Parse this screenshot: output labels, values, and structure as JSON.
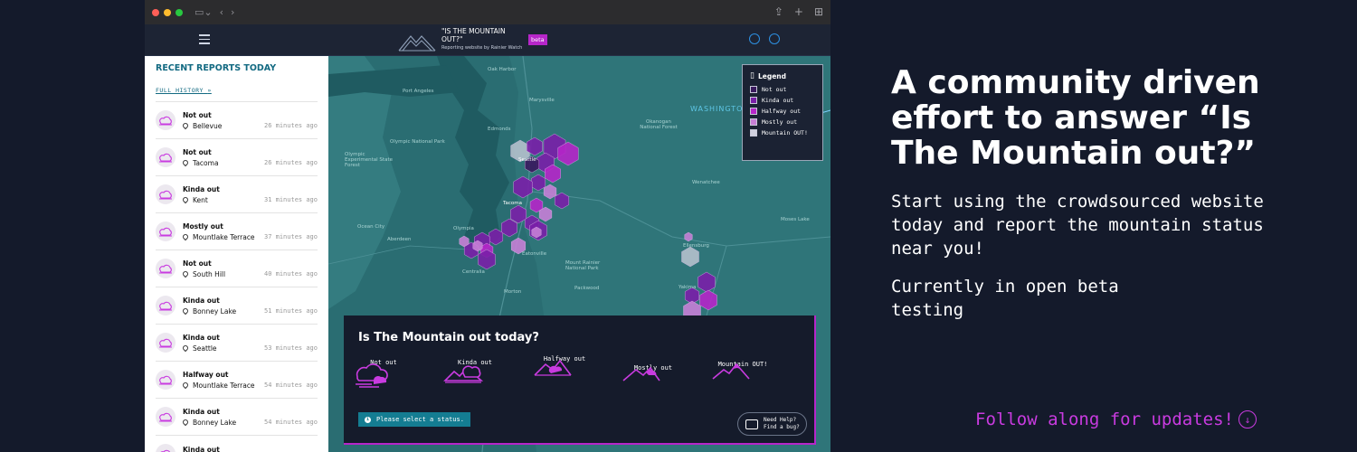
{
  "header": {
    "site_title": "\"IS THE MOUNTAIN OUT?\"",
    "site_subtitle": "Reporting website by Rainier Watch",
    "beta_badge": "beta"
  },
  "sidebar": {
    "title": "RECENT REPORTS TODAY",
    "full_history": "FULL HISTORY",
    "reports": [
      {
        "status": "Not out",
        "location": "Bellevue",
        "time": "26 minutes ago"
      },
      {
        "status": "Not out",
        "location": "Tacoma",
        "time": "26 minutes ago"
      },
      {
        "status": "Kinda out",
        "location": "Kent",
        "time": "31 minutes ago"
      },
      {
        "status": "Mostly out",
        "location": "Mountlake Terrace",
        "time": "37 minutes ago"
      },
      {
        "status": "Not out",
        "location": "South Hill",
        "time": "40 minutes ago"
      },
      {
        "status": "Kinda out",
        "location": "Bonney Lake",
        "time": "51 minutes ago"
      },
      {
        "status": "Kinda out",
        "location": "Seattle",
        "time": "53 minutes ago"
      },
      {
        "status": "Halfway out",
        "location": "Mountlake Terrace",
        "time": "54 minutes ago"
      },
      {
        "status": "Kinda out",
        "location": "Bonney Lake",
        "time": "54 minutes ago"
      },
      {
        "status": "Kinda out",
        "location": "",
        "time": ""
      }
    ]
  },
  "map": {
    "labels": [
      "Oak Harbor",
      "Port Angeles",
      "Marysville",
      "Edmonds",
      "Olympic National Park",
      "Olympic Experimental State Forest",
      "Seattle",
      "Tacoma",
      "Okanogan National Forest",
      "WASHINGTON",
      "Moses Lake",
      "Wenatchee",
      "Ellensburg",
      "Yakima",
      "Mount Rainier National Park",
      "Olympia",
      "Aberdeen",
      "Ocean City",
      "Centralia",
      "Eatonville",
      "Packwood",
      "Morton"
    ],
    "legend": {
      "title": "Legend",
      "items": [
        {
          "label": "Not out",
          "color": "#3a1a5e"
        },
        {
          "label": "Kinda out",
          "color": "#7a1fa8"
        },
        {
          "label": "Halfway out",
          "color": "#b626c9"
        },
        {
          "label": "Mostly out",
          "color": "#c77fd6"
        },
        {
          "label": "Mountain OUT!",
          "color": "#d0d0de"
        }
      ]
    }
  },
  "status_panel": {
    "title": "Is The Mountain out today?",
    "options": [
      "Not out",
      "Kinda out",
      "Halfway out",
      "Mostly out",
      "Mountain OUT!"
    ],
    "select_prompt": "Please select a status.",
    "help_line1": "Need Help?",
    "help_line2": "Find a bug?"
  },
  "marketing": {
    "headline": "A community driven effort to answer “Is The Mountain out?”",
    "body1": "Start using the crowdsourced website today and report the mountain status near you!",
    "body2": "Currently in open beta testing",
    "follow": "Follow along for updates!"
  },
  "colors": {
    "accent": "#b626c9",
    "background": "#141a2b",
    "map_teal": "#2a6d72",
    "brand_teal": "#136a82"
  }
}
